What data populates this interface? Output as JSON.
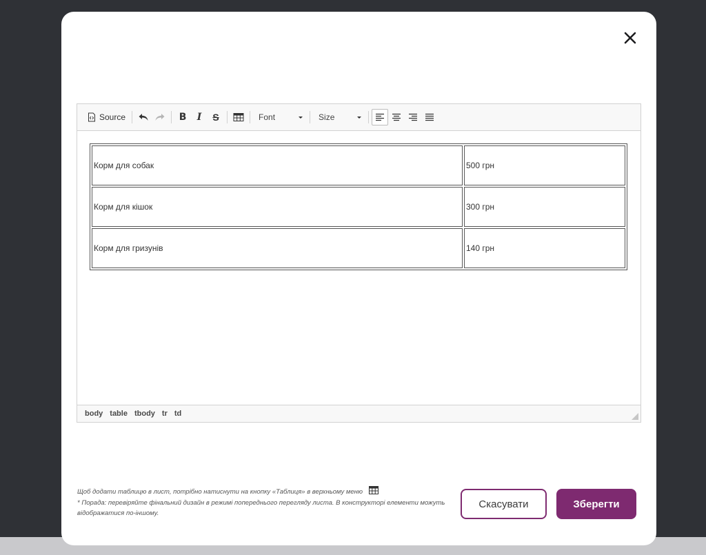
{
  "toolbar": {
    "source_label": "Source",
    "font_label": "Font",
    "size_label": "Size",
    "icons": [
      "source-icon",
      "undo-icon",
      "redo-icon",
      "bold-icon",
      "italic-icon",
      "strikethrough-icon",
      "table-icon",
      "align-left-icon",
      "align-center-icon",
      "align-right-icon",
      "justify-icon"
    ],
    "bold_glyph": "B",
    "italic_glyph": "I",
    "strike_glyph": "S"
  },
  "table": {
    "rows": [
      {
        "item": "Корм для собак",
        "price": "500 грн"
      },
      {
        "item": "Корм для кішок",
        "price": "300 грн"
      },
      {
        "item": "Корм для гризунів",
        "price": "140 грн"
      }
    ]
  },
  "statusbar": {
    "path": [
      "body",
      "table",
      "tbody",
      "tr",
      "td"
    ]
  },
  "hint": {
    "line1": "Щоб додати таблицю в лист, потрібно натиснути на кнопку «Таблиця» в верхньому меню",
    "line2": "* Порада: перевіряйте фінальний дизайн в режимі попереднього перегляду листа. В конструкторі елементи можуть відображатися по-іншому."
  },
  "buttons": {
    "cancel": "Скасувати",
    "save": "Зберегти"
  },
  "colors": {
    "accent": "#7e2a70",
    "backdrop": "#2f3136"
  }
}
